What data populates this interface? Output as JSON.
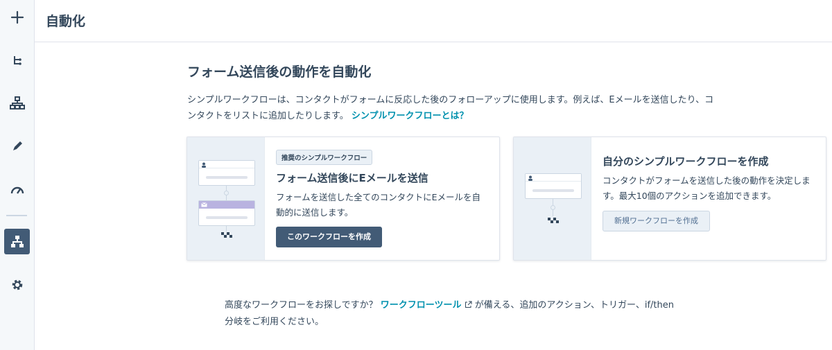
{
  "header": {
    "title": "自動化"
  },
  "rail": {
    "items": [
      {
        "icon": "plus-icon"
      },
      {
        "icon": "tree-icon"
      },
      {
        "icon": "hierarchy-icon"
      },
      {
        "icon": "pen-icon"
      },
      {
        "icon": "gauge-icon"
      },
      {
        "icon": "workflow-icon",
        "active": true
      },
      {
        "icon": "gear-icon"
      }
    ]
  },
  "main": {
    "title": "フォーム送信後の動作を自動化",
    "intro_text": "シンプルワークフローは、コンタクトがフォームに反応した後のフォローアップに使用します。例えば、Eメールを送信したり、コンタクトをリストに追加したりします。",
    "intro_link": "シンプルワークフローとは？"
  },
  "cards": [
    {
      "tag": "推奨のシンプルワークフロー",
      "title": "フォーム送信後にEメールを送信",
      "description": "フォームを送信した全てのコンタクトにEメールを自動的に送信します。",
      "button": "このワークフローを作成"
    },
    {
      "title": "自分のシンプルワークフローを作成",
      "description": "コンタクトがフォームを送信した後の動作を決定します。最大10個のアクションを追加できます。",
      "button": "新規ワークフローを作成"
    }
  ],
  "footer": {
    "prefix": "高度なワークフローをお探しですか？",
    "link": "ワークフローツール",
    "suffix": "が備える、追加のアクション、トリガー、if/then分岐をご利用ください。"
  },
  "colors": {
    "accent": "#0091ae",
    "dark_button": "#425b76",
    "text": "#33475b",
    "rail_bg": "#f5f8fa"
  }
}
